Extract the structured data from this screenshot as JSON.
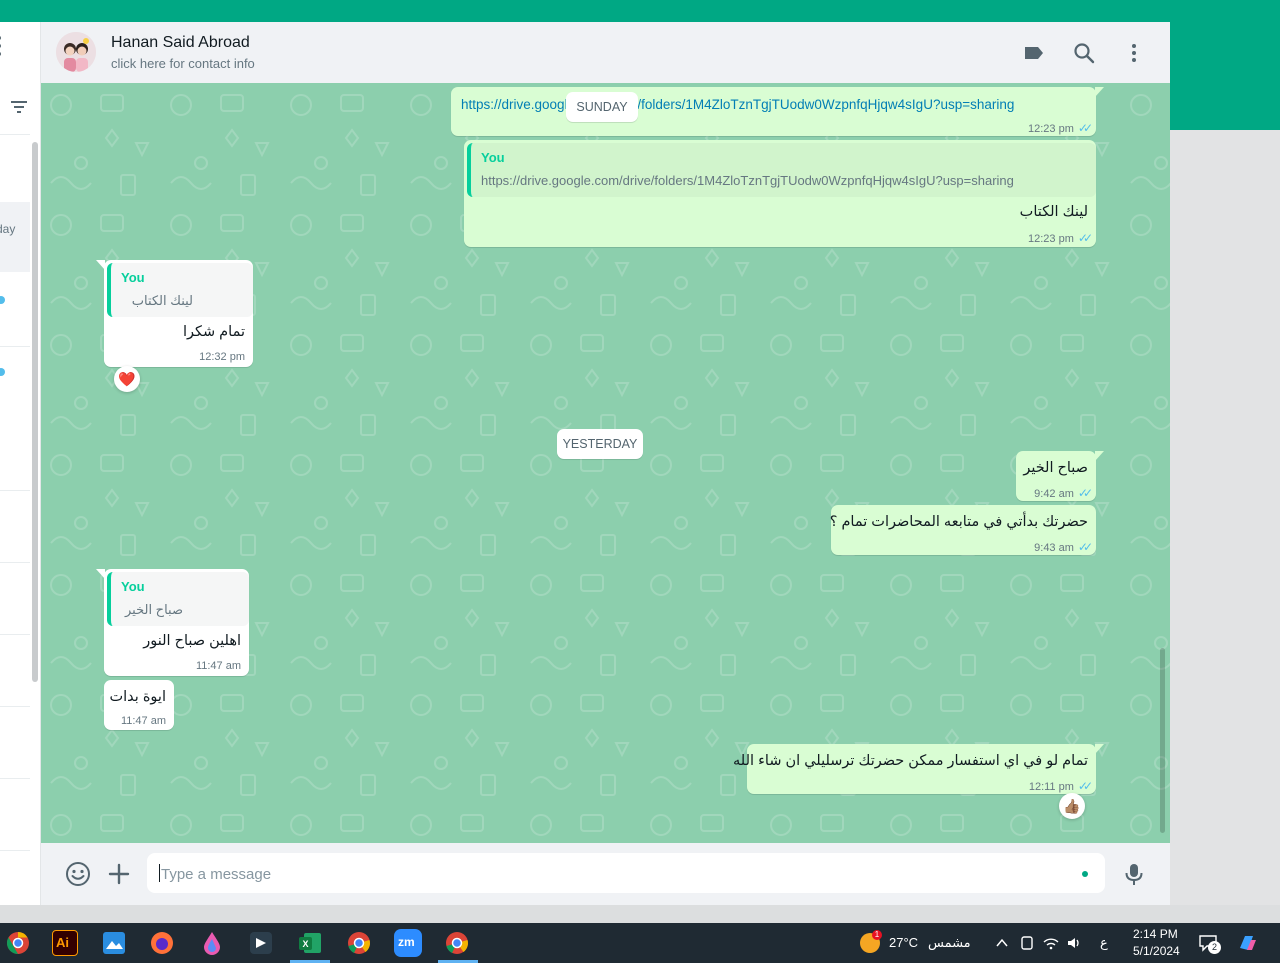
{
  "header": {
    "contact_name": "Hanan Said Abroad",
    "contact_sub": "click here for contact info",
    "label_icon": "label-icon",
    "search_icon": "search-icon",
    "menu_icon": "more-vertical-icon"
  },
  "left_panel": {
    "item_text_1": "day",
    "item_text_2": "\""
  },
  "dates": {
    "sunday": "SUNDAY",
    "yesterday": "YESTERDAY"
  },
  "messages": [
    {
      "dir": "out",
      "text": "https://drive.google.com/drive/folders/1M4ZloTznTgjTUodw0WzpnfqHjqw4sIgU?usp=sharing",
      "time": "12:23 pm",
      "ticks": "✓✓"
    },
    {
      "dir": "out",
      "quote_author": "You",
      "quote_text": "https://drive.google.com/drive/folders/1M4ZloTznTgjTUodw0WzpnfqHjqw4sIgU?usp=sharing",
      "text": "لينك الكتاب",
      "time": "12:23 pm",
      "ticks": "✓✓"
    },
    {
      "dir": "in",
      "quote_author": "You",
      "quote_text": "لينك الكتاب",
      "text": "تمام شكرا",
      "time": "12:32 pm",
      "reaction": "❤️"
    },
    {
      "dir": "out",
      "text": "صباح الخير",
      "time": "9:42 am",
      "ticks": "✓✓"
    },
    {
      "dir": "out",
      "text": "حضرتك بدأتي في متابعه المحاضرات تمام ؟",
      "time": "9:43 am",
      "ticks": "✓✓"
    },
    {
      "dir": "in",
      "quote_author": "You",
      "quote_text": "صباح الخير",
      "text": "اهلين صباح النور",
      "time": "11:47 am"
    },
    {
      "dir": "in",
      "text": "ايوة بدات",
      "time": "11:47 am"
    },
    {
      "dir": "out",
      "text": "تمام لو في اي استفسار ممكن حضرتك ترسليلي ان شاء الله",
      "time": "12:11 pm",
      "ticks": "✓✓",
      "reaction": "👍🏽"
    }
  ],
  "composer": {
    "placeholder": "Type a message",
    "emoji_icon": "emoji-icon",
    "attach_icon": "plus-icon",
    "mic_icon": "microphone-icon"
  },
  "taskbar": {
    "weather_badge": "1",
    "temperature": "27°C",
    "weather_text": "مشمس",
    "lang": "ع",
    "time": "2:14 PM",
    "date": "5/1/2024",
    "notif_count": "2",
    "apps": [
      "chrome-profile-icon",
      "illustrator-icon",
      "paint-icon",
      "firefox-icon",
      "drop-icon",
      "capcut-icon",
      "excel-icon",
      "chrome-icon",
      "zoom-icon",
      "chrome-active-icon"
    ],
    "illustrator_label": "Ai",
    "zoom_label": "zm"
  },
  "colors": {
    "accent": "#00a884",
    "chat_bg": "#8ccfad",
    "outgoing": "#d9fdd3",
    "incoming": "#ffffff",
    "tick_blue": "#53bdeb"
  }
}
